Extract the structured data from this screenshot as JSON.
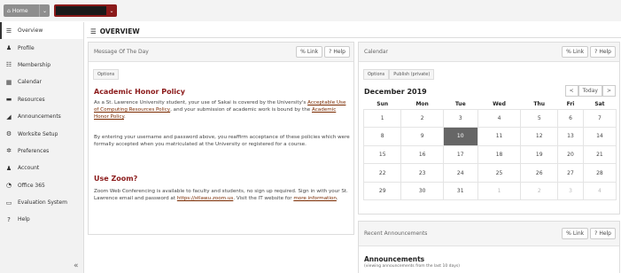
{
  "topbar": {
    "home_label": "Home",
    "home_caret": "⌄",
    "site_caret": "⌄"
  },
  "sidebar": {
    "items": [
      {
        "label": "Overview",
        "icon": "☰"
      },
      {
        "label": "Profile",
        "icon": "♟"
      },
      {
        "label": "Membership",
        "icon": "☷"
      },
      {
        "label": "Calendar",
        "icon": "▦"
      },
      {
        "label": "Resources",
        "icon": "▬"
      },
      {
        "label": "Announcements",
        "icon": "◢"
      },
      {
        "label": "Worksite Setup",
        "icon": "⚙"
      },
      {
        "label": "Preferences",
        "icon": "✲"
      },
      {
        "label": "Account",
        "icon": "♟"
      },
      {
        "label": "Office 365",
        "icon": "◔"
      },
      {
        "label": "Evaluation System",
        "icon": "▭"
      },
      {
        "label": "Help",
        "icon": "?"
      }
    ],
    "collapse_glyph": "«"
  },
  "main": {
    "title": "OVERVIEW",
    "title_icon": "☰"
  },
  "motd": {
    "title": "Message Of The Day",
    "link_label": "Link",
    "help_label": "Help",
    "options_label": "Options",
    "heading1": "Academic Honor Policy",
    "p1_a": "As a St. Lawrence University student, your use of Sakai is covered by the University's ",
    "p1_link1": "Acceptable Use of Computing Resources Policy",
    "p1_b": ", and your submission of academic work is bound by the ",
    "p1_link2": "Academic Honor Policy",
    "p1_c": ".",
    "p2": "By entering your username and password above, you reaffirm acceptance of these policies which were formally accepted when you matriculated at the University or registered for a course.",
    "heading2": "Use Zoom?",
    "p3_a": "Zoom Web Conferencing is available to faculty and students, no sign up required. Sign in with your St. Lawrence email and password at ",
    "p3_link1": "https://stlawu.zoom.us",
    "p3_b": ". Visit the IT website for ",
    "p3_link2": "more information",
    "p3_c": "."
  },
  "calendar": {
    "title": "Calendar",
    "link_label": "Link",
    "help_label": "Help",
    "options_label": "Options",
    "publish_label": "Publish (private)",
    "month": "December 2019",
    "prev": "<",
    "today": "Today",
    "next": ">",
    "days": [
      "Sun",
      "Mon",
      "Tue",
      "Wed",
      "Thu",
      "Fri",
      "Sat"
    ],
    "weeks": [
      [
        "1",
        "2",
        "3",
        "4",
        "5",
        "6",
        "7"
      ],
      [
        "8",
        "9",
        "10",
        "11",
        "12",
        "13",
        "14"
      ],
      [
        "15",
        "16",
        "17",
        "18",
        "19",
        "20",
        "21"
      ],
      [
        "22",
        "23",
        "24",
        "25",
        "26",
        "27",
        "28"
      ],
      [
        "29",
        "30",
        "31",
        "1",
        "2",
        "3",
        "4"
      ]
    ],
    "today_date": "10"
  },
  "announcements": {
    "title": "Recent Announcements",
    "link_label": "Link",
    "help_label": "Help",
    "heading": "Announcements",
    "subtitle": "(viewing announcements from the last 10 days)"
  }
}
